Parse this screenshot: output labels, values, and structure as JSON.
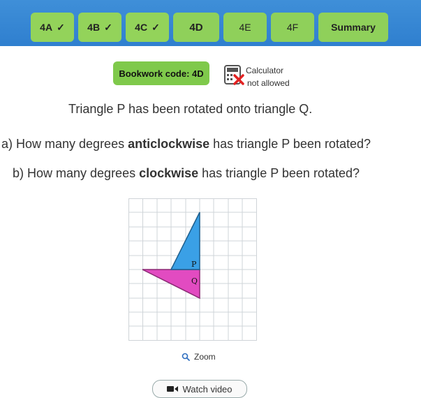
{
  "tabs": [
    {
      "label": "4A",
      "done": true
    },
    {
      "label": "4B",
      "done": true
    },
    {
      "label": "4C",
      "done": true
    },
    {
      "label": "4D",
      "current": true
    },
    {
      "label": "4E"
    },
    {
      "label": "4F"
    },
    {
      "label": "Summary"
    }
  ],
  "tick": "✓",
  "bookwork": {
    "label": "Bookwork code: 4D"
  },
  "calculator": {
    "line1": "Calculator",
    "line2": "not allowed"
  },
  "question": {
    "intro": "Triangle P has been rotated onto triangle Q.",
    "a_prefix": "a) How many degrees ",
    "a_bold": "anticlockwise",
    "a_suffix": " has triangle P been rotated?",
    "b_prefix": "b) How many degrees ",
    "b_bold": "clockwise",
    "b_suffix": " has triangle P been rotated?"
  },
  "diagram": {
    "label_p": "P",
    "label_q": "Q",
    "color_p": "#3aa0e6",
    "color_q": "#e24bc1"
  },
  "zoom": {
    "label": "Zoom"
  },
  "watch_video": {
    "label": "Watch video"
  }
}
